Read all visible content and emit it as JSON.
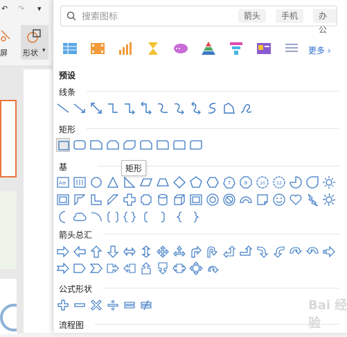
{
  "left_strip": {
    "screen_label": "屏",
    "shape_label": "形状",
    "dropdown_arrow": "▾",
    "undo_icon": "undo-icon",
    "redo_icon": "redo-icon"
  },
  "search": {
    "placeholder": "搜索图标",
    "chips": [
      "箭头",
      "手机",
      "办公"
    ]
  },
  "categories": {
    "icons": [
      "table-icon",
      "filmstrip-icon",
      "bar-chart-icon",
      "hourglass-icon",
      "cloud-bubble-icon",
      "pyramid-icon",
      "funnel-icon",
      "image-card-icon",
      "list-icon"
    ],
    "more_label": "更多"
  },
  "panel": {
    "preset_label": "预设",
    "sections": {
      "lines": "线条",
      "rect": "矩形",
      "basic": "基",
      "arrows": "箭头总汇",
      "equation": "公式形状",
      "flowchart": "流程图"
    },
    "basic_numbers": [
      "7",
      "8",
      "10",
      "12"
    ],
    "text_box_icon_text": "A≡"
  },
  "tooltip": {
    "text": "矩形"
  },
  "colors": {
    "accent": "#2f6fce",
    "shape_stroke": "#3a78c3",
    "panel_bg": "#ffffff"
  }
}
